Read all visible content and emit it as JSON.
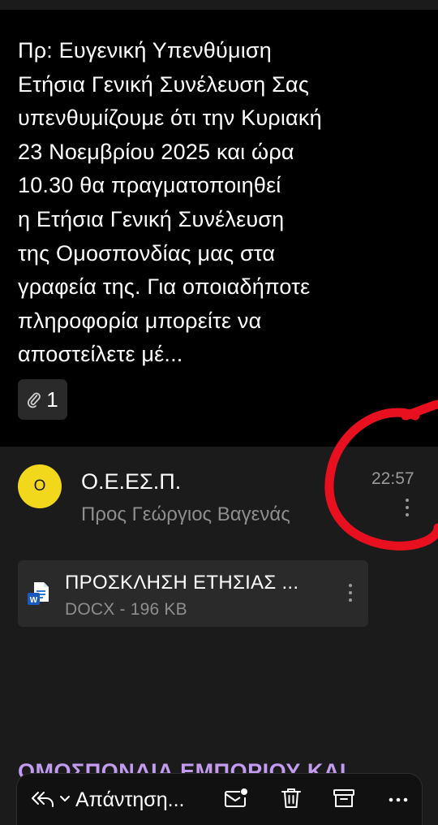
{
  "preview": {
    "text": "Πρ: Ευγενική Υπενθύμιση\nΕτήσια Γενική Συνέλευση Σας\nυπενθυμίζουμε ότι την Κυριακή\n23 Νοεμβρίου 2025 και ώρα\n10.30 θα πραγματοποιηθεί\nη Ετήσια Γενική Συνέλευση\nτης Ομοσπονδίας μας στα\nγραφεία της.  Για οποιαδήποτε\nπληροφορία μπορείτε να\nαποστείλετε μέ...",
    "attachment_icon": "paperclip-icon",
    "attachment_count": "1"
  },
  "message": {
    "avatar_initial": "Ο",
    "avatar_color": "#f2d81c",
    "sender": "Ο.Ε.ΕΣ.Π.",
    "recipient": "Προς Γεώργιος Βαγενάς",
    "time": "22:57",
    "more_icon": "vertical-dots-icon"
  },
  "attachment": {
    "icon": "word-document-icon",
    "name": "ΠΡΟΣΚΛΗΣΗ ΕΤΗΣΙΑΣ ...",
    "meta": "DOCX - 196 KB",
    "more_icon": "vertical-dots-icon"
  },
  "body_heading": "ΟΜΟΣΠΟΝΔΙΑ ΕΜΠΟΡΙΟΥ ΚΑΙ",
  "annotation": {
    "shape": "hand-drawn-circle",
    "color": "#e8101f"
  },
  "toolbar": {
    "reply_icon": "reply-all-icon",
    "dropdown_icon": "chevron-down-icon",
    "reply_label": "Απάντηση...",
    "mark_unread_icon": "mark-unread-icon",
    "delete_icon": "trash-icon",
    "archive_icon": "archive-icon",
    "more_icon": "more-horizontal-icon"
  },
  "colors": {
    "background": "#1b1b1b",
    "preview_background": "#000000",
    "secondary_text": "#8e8e8e",
    "accent_purple": "#c39bf0"
  }
}
